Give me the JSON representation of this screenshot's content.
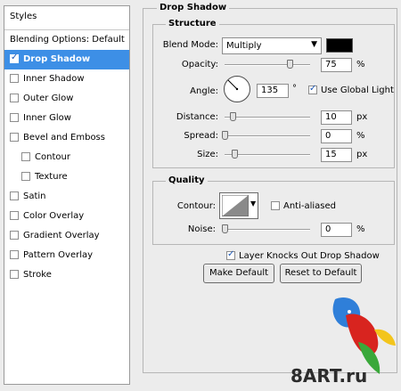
{
  "left_panel": {
    "header": "Styles",
    "blending_options": "Blending Options: Default",
    "items": [
      {
        "label": "Drop Shadow",
        "checked": true
      },
      {
        "label": "Inner Shadow",
        "checked": false
      },
      {
        "label": "Outer Glow",
        "checked": false
      },
      {
        "label": "Inner Glow",
        "checked": false
      },
      {
        "label": "Bevel and Emboss",
        "checked": false
      },
      {
        "label": "Contour",
        "checked": false
      },
      {
        "label": "Texture",
        "checked": false
      },
      {
        "label": "Satin",
        "checked": false
      },
      {
        "label": "Color Overlay",
        "checked": false
      },
      {
        "label": "Gradient Overlay",
        "checked": false
      },
      {
        "label": "Pattern Overlay",
        "checked": false
      },
      {
        "label": "Stroke",
        "checked": false
      }
    ]
  },
  "drop_shadow": {
    "title": "Drop Shadow",
    "structure": {
      "title": "Structure",
      "blend_mode_label": "Blend Mode:",
      "blend_mode_value": "Multiply",
      "shadow_color": "#000000",
      "opacity_label": "Opacity:",
      "opacity_value": "75",
      "opacity_unit": "%",
      "angle_label": "Angle:",
      "angle_value": "135",
      "angle_unit": "°",
      "use_global_light_label": "Use Global Light",
      "use_global_light": true,
      "distance_label": "Distance:",
      "distance_value": "10",
      "distance_unit": "px",
      "spread_label": "Spread:",
      "spread_value": "0",
      "spread_unit": "%",
      "size_label": "Size:",
      "size_value": "15",
      "size_unit": "px"
    },
    "quality": {
      "title": "Quality",
      "contour_label": "Contour:",
      "anti_aliased_label": "Anti-aliased",
      "anti_aliased": false,
      "noise_label": "Noise:",
      "noise_value": "0",
      "noise_unit": "%"
    },
    "knockout_label": "Layer Knocks Out Drop Shadow",
    "knockout": true,
    "make_default_label": "Make Default",
    "reset_default_label": "Reset to Default"
  },
  "watermark": {
    "text": "8ART.ru",
    "colors": {
      "blue": "#2f7fd9",
      "red": "#d8241f",
      "green": "#3aa83a",
      "yellow": "#f3c51c"
    }
  }
}
